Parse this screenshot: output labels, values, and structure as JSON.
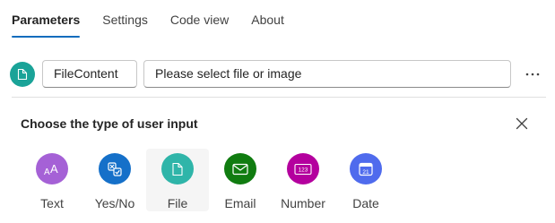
{
  "tabs": [
    {
      "label": "Parameters",
      "active": true
    },
    {
      "label": "Settings",
      "active": false
    },
    {
      "label": "Code view",
      "active": false
    },
    {
      "label": "About",
      "active": false
    }
  ],
  "parameter": {
    "icon": "file-icon",
    "icon_color": "#1aa398",
    "name": "FileContent",
    "value_placeholder": "Please select file or image",
    "more_label": "···"
  },
  "chooser": {
    "title": "Choose the type of user input",
    "close_icon": "close-icon",
    "options": [
      {
        "label": "Text",
        "icon": "text-icon",
        "color": "#a561d6"
      },
      {
        "label": "Yes/No",
        "icon": "yes-no-icon",
        "color": "#1570c9"
      },
      {
        "label": "File",
        "icon": "file-icon",
        "color": "#2fb5a9",
        "selected": true
      },
      {
        "label": "Email",
        "icon": "mail-icon",
        "color": "#107c10"
      },
      {
        "label": "Number",
        "icon": "number-icon",
        "color": "#b4009e"
      },
      {
        "label": "Date",
        "icon": "calendar-icon",
        "color": "#4f6bed"
      }
    ]
  },
  "accent_color": "#0f6cbd"
}
